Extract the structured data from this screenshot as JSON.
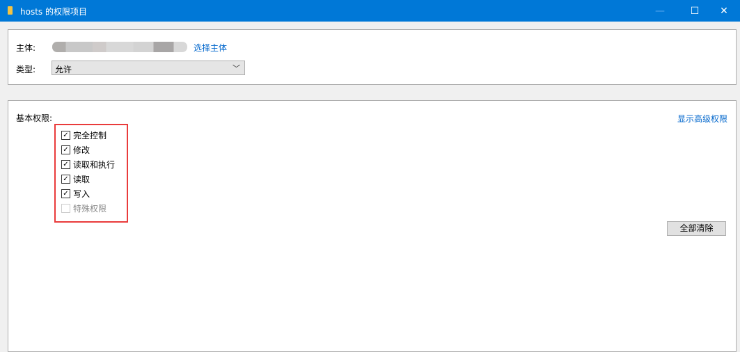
{
  "window": {
    "title": "hosts 的权限项目",
    "minimize": "—",
    "maximize": "☐",
    "close": "✕"
  },
  "principal": {
    "label": "主体:",
    "select_link": "选择主体"
  },
  "type": {
    "label": "类型:",
    "value": "允许"
  },
  "permissions": {
    "label": "基本权限:",
    "advanced_link": "显示高级权限",
    "clear_all": "全部清除",
    "items": [
      {
        "label": "完全控制",
        "checked": true
      },
      {
        "label": "修改",
        "checked": true
      },
      {
        "label": "读取和执行",
        "checked": true
      },
      {
        "label": "读取",
        "checked": true
      },
      {
        "label": "写入",
        "checked": true
      },
      {
        "label": "特殊权限",
        "checked": false
      }
    ]
  }
}
